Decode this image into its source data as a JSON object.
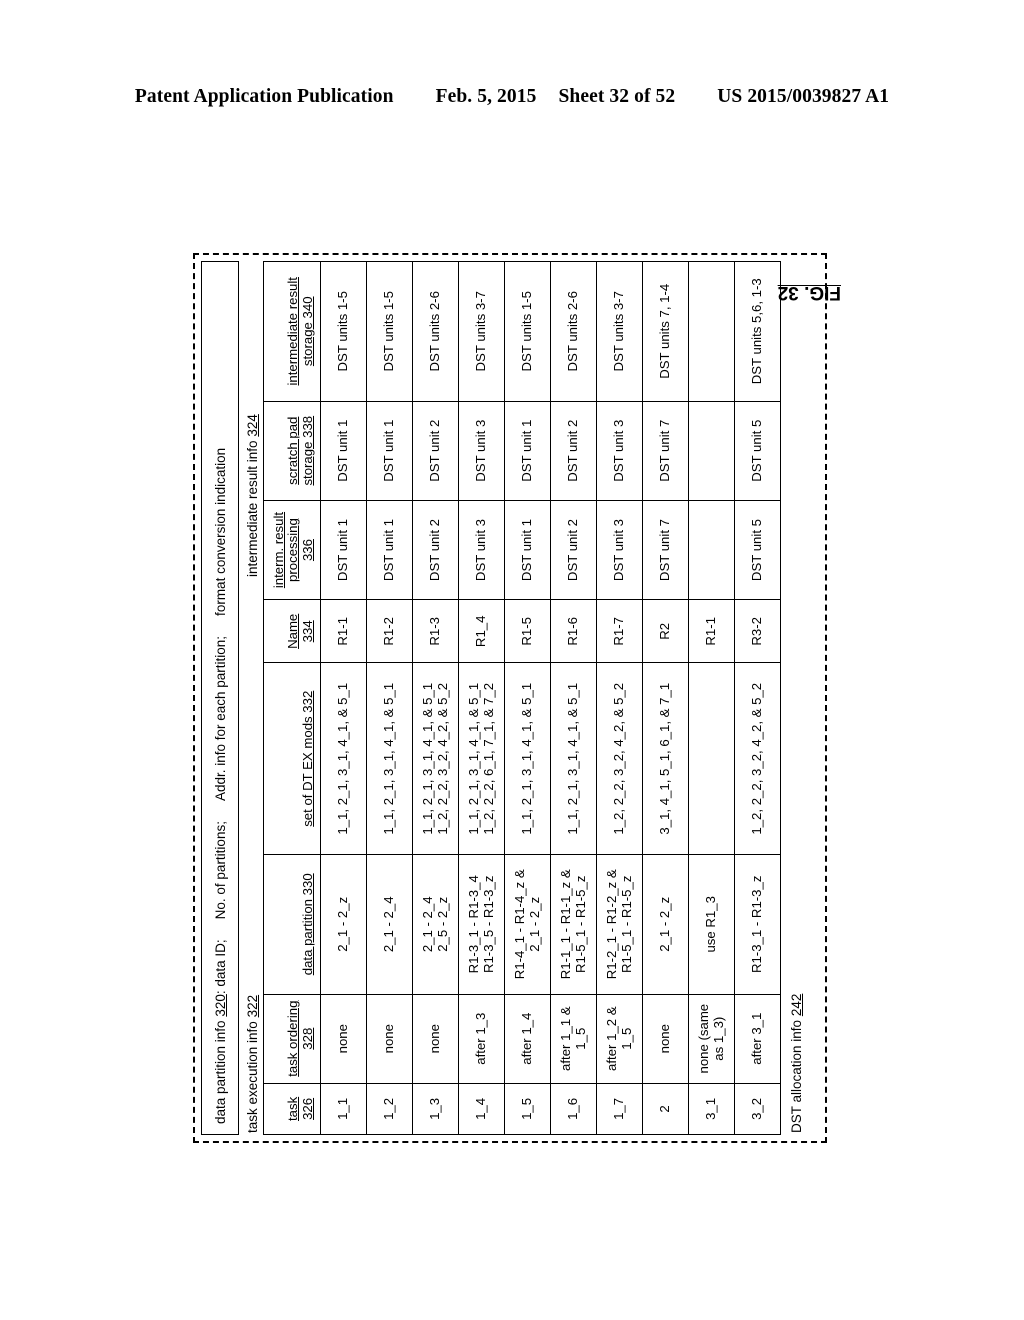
{
  "header": {
    "publication": "Patent Application Publication",
    "date": "Feb. 5, 2015",
    "sheet": "Sheet 32 of 52",
    "patent_number": "US 2015/0039827 A1"
  },
  "figure": {
    "label": "FIG. 32",
    "alloc_title": "DST allocation info",
    "alloc_title_ref": "242",
    "partition_info": {
      "title": "data partition info",
      "title_ref": "320",
      "fields": [
        ": data ID;",
        "No. of partitions;",
        "Addr. info for each partition;",
        "format conversion indication"
      ]
    },
    "task_execution_info": {
      "label": "task execution info",
      "ref": "322"
    },
    "intermediate_result_info": {
      "label": "intermediate result info",
      "ref": "324"
    },
    "columns": [
      {
        "line1": "task",
        "line2": "326",
        "key": "task"
      },
      {
        "line1": "task ordering",
        "line2": "328",
        "key": "ordering"
      },
      {
        "line1": "data partition 330",
        "line2": "",
        "key": "partition"
      },
      {
        "line1": "set of DT EX mods 332",
        "line2": "",
        "key": "dtex"
      },
      {
        "line1": "Name",
        "line2": "334",
        "key": "name"
      },
      {
        "line1": "interm. result",
        "line2": "processing",
        "line3": "336",
        "key": "proc"
      },
      {
        "line1": "scratch pad",
        "line2": "storage 338",
        "key": "scratch"
      },
      {
        "line1": "intermediate result",
        "line2": "storage 340",
        "key": "storage"
      }
    ],
    "rows": [
      {
        "task": "1_1",
        "ordering": [
          "none"
        ],
        "partition": [
          "2_1 - 2_z"
        ],
        "dtex": [
          "1_1, 2_1, 3_1, 4_1, & 5_1"
        ],
        "name": "R1-1",
        "proc": "DST unit 1",
        "scratch": "DST unit 1",
        "storage": "DST units 1-5"
      },
      {
        "task": "1_2",
        "ordering": [
          "none"
        ],
        "partition": [
          "2_1 - 2_4"
        ],
        "dtex": [
          "1_1, 2_1, 3_1, 4_1, & 5_1"
        ],
        "name": "R1-2",
        "proc": "DST unit 1",
        "scratch": "DST unit 1",
        "storage": "DST units 1-5"
      },
      {
        "task": "1_3",
        "ordering": [
          "none"
        ],
        "partition": [
          "2_1 - 2_4",
          "2_5 - 2_z"
        ],
        "dtex": [
          "1_1, 2_1, 3_1, 4_1, & 5_1",
          "1_2, 2_2, 3_2, 4_2, & 5_2"
        ],
        "name": "R1-3",
        "proc": "DST unit 2",
        "scratch": "DST unit 2",
        "storage": "DST units 2-6"
      },
      {
        "task": "1_4",
        "ordering": [
          "after 1_3"
        ],
        "partition": [
          "R1-3_1 - R1-3_4",
          "R1-3_5 - R1-3_z"
        ],
        "dtex": [
          "1_1, 2_1, 3_1, 4_1, & 5_1",
          "1_2, 2_2, 6_1, 7_1, & 7_2"
        ],
        "name": "R1_4",
        "proc": "DST unit 3",
        "scratch": "DST unit 3",
        "storage": "DST units 3-7"
      },
      {
        "task": "1_5",
        "ordering": [
          "after 1_4"
        ],
        "partition": [
          "R1-4_1 - R1-4_z &",
          "2_1 - 2_z"
        ],
        "dtex": [
          "1_1, 2_1, 3_1, 4_1, & 5_1"
        ],
        "name": "R1-5",
        "proc": "DST unit 1",
        "scratch": "DST unit 1",
        "storage": "DST units 1-5"
      },
      {
        "task": "1_6",
        "ordering": [
          "after 1_1 &",
          "1_5"
        ],
        "partition": [
          "R1-1_1 - R1-1_z &",
          "R1-5_1 - R1-5_z"
        ],
        "dtex": [
          "1_1, 2_1, 3_1, 4_1, & 5_1"
        ],
        "name": "R1-6",
        "proc": "DST unit 2",
        "scratch": "DST unit 2",
        "storage": "DST units 2-6"
      },
      {
        "task": "1_7",
        "ordering": [
          "after 1_2 &",
          "1_5"
        ],
        "partition": [
          "R1-2_1 - R1-2_z &",
          "R1-5_1 - R1-5_z"
        ],
        "dtex": [
          "1_2, 2_2, 3_2, 4_2, & 5_2"
        ],
        "name": "R1-7",
        "proc": "DST unit 3",
        "scratch": "DST unit 3",
        "storage": "DST units 3-7"
      },
      {
        "task": "2",
        "ordering": [
          "none"
        ],
        "partition": [
          "2_1 - 2_z"
        ],
        "dtex": [
          "3_1, 4_1, 5_1, 6_1, & 7_1"
        ],
        "name": "R2",
        "proc": "DST unit 7",
        "scratch": "DST unit 7",
        "storage": "DST units 7, 1-4"
      },
      {
        "task": "3_1",
        "ordering": [
          "none (same",
          "as 1_3)"
        ],
        "partition": [
          "use R1_3"
        ],
        "dtex": [
          ""
        ],
        "name": "R1-1",
        "proc": "",
        "scratch": "",
        "storage": ""
      },
      {
        "task": "3_2",
        "ordering": [
          "after 3_1"
        ],
        "partition": [
          "R1-3_1 - R1-3_z"
        ],
        "dtex": [
          "1_2, 2_2, 3_2, 4_2, & 5_2"
        ],
        "name": "R3-2",
        "proc": "DST unit 5",
        "scratch": "DST unit 5",
        "storage": "DST units 5,6, 1-3"
      }
    ]
  }
}
